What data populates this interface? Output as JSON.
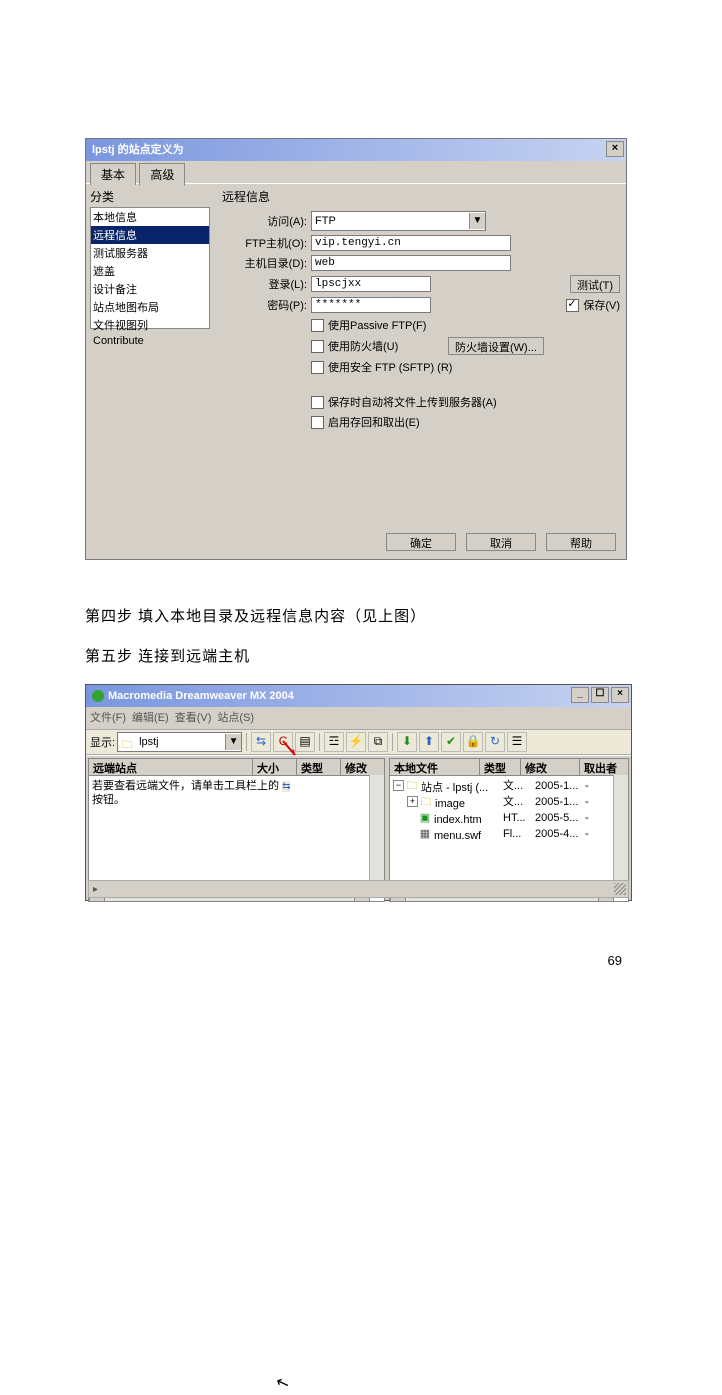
{
  "dlg1": {
    "title": "lpstj 的站点定义为",
    "tab_basic": "基本",
    "tab_adv": "高级",
    "cat_label": "分类",
    "categories": [
      "本地信息",
      "远程信息",
      "测试服务器",
      "遮盖",
      "设计备注",
      "站点地图布局",
      "文件视图列",
      "Contribute"
    ],
    "panel_title": "远程信息",
    "access_label": "访问(A):",
    "access_value": "FTP",
    "host_label": "FTP主机(O):",
    "host_value": "vip.tengyi.cn",
    "dir_label": "主机目录(D):",
    "dir_value": "web",
    "login_label": "登录(L):",
    "login_value": "lpscjxx",
    "test_btn": "测试(T)",
    "pass_label": "密码(P):",
    "pass_value": "*******",
    "save_chk": "保存(V)",
    "passive": "使用Passive FTP(F)",
    "firewall": "使用防火墙(U)",
    "firewall_btn": "防火墙设置(W)...",
    "sftp": "使用安全 FTP (SFTP) (R)",
    "autoupload": "保存时自动将文件上传到服务器(A)",
    "checkinout": "启用存回和取出(E)",
    "ok": "确定",
    "cancel": "取消",
    "help": "帮助"
  },
  "para1": "第四步 填入本地目录及远程信息内容（见上图）",
  "para2": "第五步  连接到远端主机",
  "dlg2": {
    "title": "Macromedia Dreamweaver MX 2004",
    "menu": [
      "文件(F)",
      "编辑(E)",
      "查看(V)",
      "站点(S)"
    ],
    "show_label": "显示:",
    "show_value": "lpstj",
    "left_head": [
      "远端站点",
      "大小",
      "类型",
      "修改"
    ],
    "left_text1": "若要查看远端文件，请单击工具栏上的",
    "left_text2": "按钮。",
    "right_head": [
      "本地文件",
      "类型",
      "修改",
      "取出者"
    ],
    "rows": [
      {
        "name": "站点 - lpstj (...",
        "type": "文...",
        "date": "2005-1...",
        "by": "-"
      },
      {
        "name": "image",
        "type": "文...",
        "date": "2005-1...",
        "by": "-"
      },
      {
        "name": "index.htm",
        "type": "HT...",
        "date": "2005-5...",
        "by": "-"
      },
      {
        "name": "menu.swf",
        "type": "Fl...",
        "date": "2005-4...",
        "by": "-"
      }
    ]
  },
  "page": "69"
}
